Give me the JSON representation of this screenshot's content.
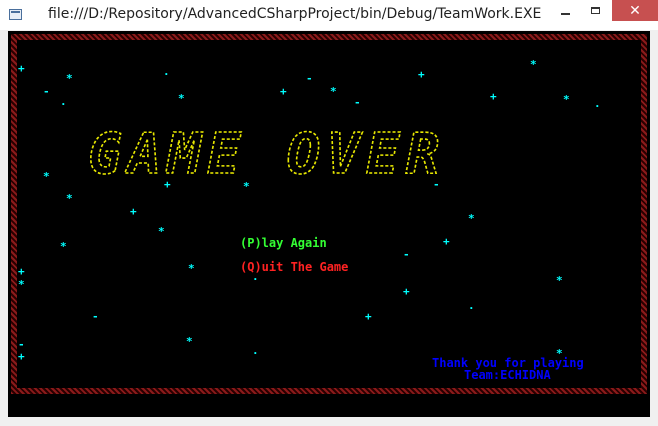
{
  "window": {
    "title": "file:///D:/Repository/AdvancedCSharpProject/bin/Debug/TeamWork.EXE",
    "close_glyph": "✕"
  },
  "game": {
    "logo_text": "GAME OVER",
    "logo_color": "#e8e800",
    "menu": [
      {
        "label": "(P)lay Again",
        "color": "#33ff33"
      },
      {
        "label": "(Q)uit The Game",
        "color": "#ff2222"
      }
    ],
    "credits": {
      "line1": "Thank you for playing",
      "line2": "Team:ECHIDNA",
      "color": "#0000ff"
    },
    "star_color": "#00ffff",
    "border_color": "#8a1a1a"
  },
  "stars": [
    "+",
    "*",
    "·",
    "-",
    "+",
    "*",
    "-",
    "·",
    "*",
    "+",
    "*",
    "-",
    "+",
    "*",
    "·",
    "*",
    "+",
    "*",
    "-",
    "*",
    "+",
    "*",
    "*",
    "+",
    "*",
    "-",
    "*",
    "·",
    "*",
    "+"
  ]
}
